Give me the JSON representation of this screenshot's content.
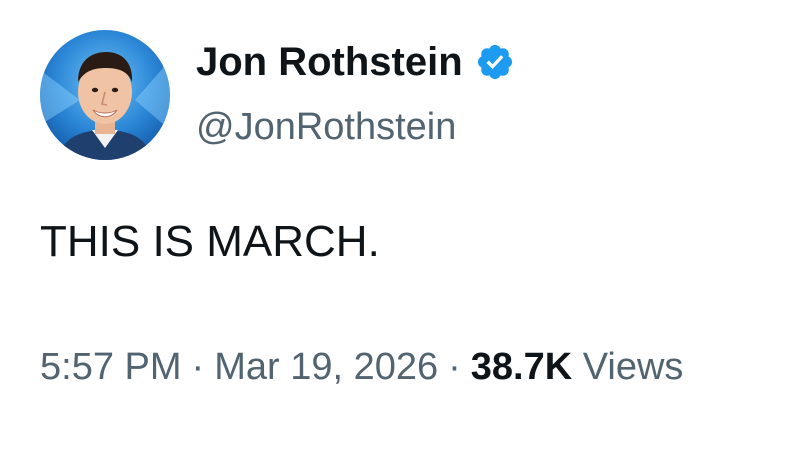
{
  "author": {
    "display_name": "Jon Rothstein",
    "handle": "@JonRothstein",
    "verified": true,
    "verified_color": "#1d9bf0"
  },
  "tweet": {
    "text": "THIS IS MARCH."
  },
  "meta": {
    "time": "5:57 PM",
    "separator": "·",
    "date": "Mar 19, 2026",
    "views_count": "38.7K",
    "views_label": "Views"
  },
  "colors": {
    "text_primary": "#0f1419",
    "text_secondary": "#536471",
    "background": "#ffffff"
  }
}
